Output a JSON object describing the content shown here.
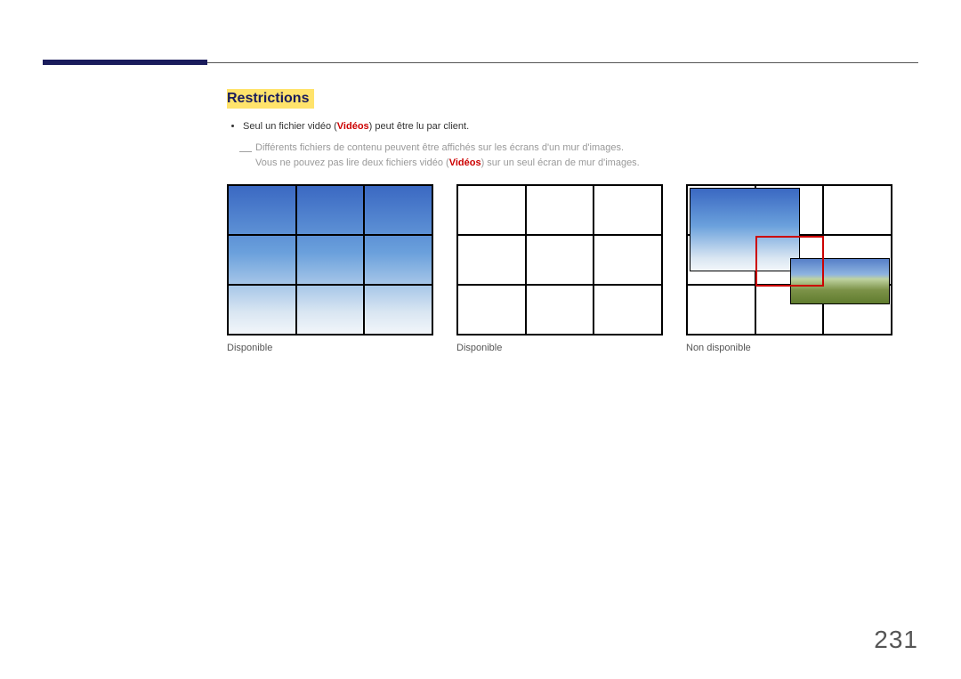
{
  "section": {
    "title": "Restrictions"
  },
  "bullet1_pre": "Seul un fichier vidéo (",
  "videos_label": "Vidéos",
  "bullet1_post": ") peut être lu par client.",
  "note_line1": "Différents fichiers de contenu peuvent être affichés sur les écrans d'un mur d'images.",
  "note_line2_pre": "Vous ne pouvez pas lire deux fichiers vidéo (",
  "note_line2_post": ") sur un seul écran de mur d'images.",
  "captions": {
    "wall1": "Disponible",
    "wall2": "Disponible",
    "wall3": "Non disponible"
  },
  "page_number": "231"
}
